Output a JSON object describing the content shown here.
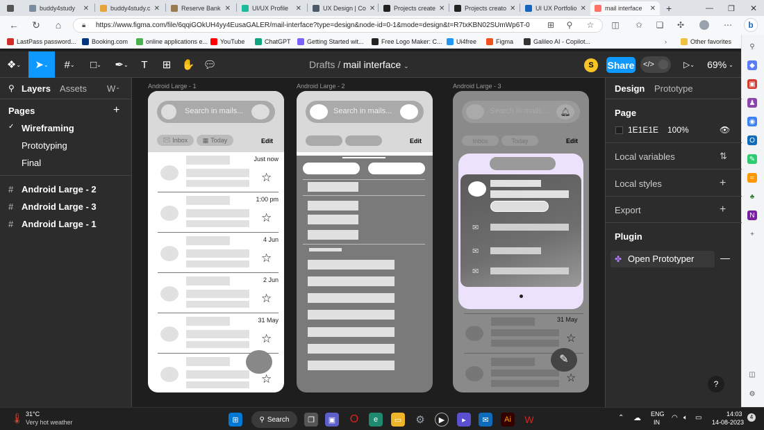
{
  "browser": {
    "tabs": [
      {
        "label": "",
        "active": false
      },
      {
        "label": "buddy4study",
        "active": false
      },
      {
        "label": "buddy4study.c",
        "active": false
      },
      {
        "label": "Reserve Bank",
        "active": false
      },
      {
        "label": "UI/UX Profile",
        "active": false
      },
      {
        "label": "UX Design | Co",
        "active": false
      },
      {
        "label": "Projects create",
        "active": false
      },
      {
        "label": "Projects creato",
        "active": false
      },
      {
        "label": "UI UX Portfolio",
        "active": false
      },
      {
        "label": "mail interface",
        "active": true
      }
    ],
    "url": "https://www.figma.com/file/6qqiGOkUH4yy4EusaGALER/mail-interface?type=design&node-id=0-1&mode=design&t=R7txKBN02SUmWp6T-0",
    "bookmarks": [
      {
        "label": "LastPass password...",
        "color": "#d32d27"
      },
      {
        "label": "Booking.com",
        "color": "#003580"
      },
      {
        "label": "online applications e...",
        "color": "#4caf50"
      },
      {
        "label": "YouTube",
        "color": "#ff0000"
      },
      {
        "label": "ChatGPT",
        "color": "#10a37f"
      },
      {
        "label": "Getting Started wit...",
        "color": "#7b61ff"
      },
      {
        "label": "Free Logo Maker: C...",
        "color": "#222222"
      },
      {
        "label": "Ui4free",
        "color": "#2196f3"
      },
      {
        "label": "Figma",
        "color": "#f24e1e"
      },
      {
        "label": "Galileo AI - Copilot...",
        "color": "#333333"
      }
    ],
    "other_favorites": "Other favorites"
  },
  "figma": {
    "breadcrumb_root": "Drafts",
    "breadcrumb_sep": "/",
    "file_name": "mail interface",
    "avatar_initial": "S",
    "share_label": "Share",
    "zoom": "69%",
    "left_tabs": {
      "layers": "Layers",
      "assets": "Assets",
      "more": "W"
    },
    "pages_title": "Pages",
    "pages": [
      "Wireframing",
      "Prototyping",
      "Final"
    ],
    "active_page_check": "✓",
    "frames": [
      "Android Large - 2",
      "Android Large - 3",
      "Android Large - 1"
    ],
    "right_tabs": {
      "design": "Design",
      "prototype": "Prototype"
    },
    "page_section": "Page",
    "page_color": "1E1E1E",
    "page_opacity": "100%",
    "sections": [
      "Local variables",
      "Local styles",
      "Export"
    ],
    "plugin_title": "Plugin",
    "plugin_name": "Open Prototyper",
    "help": "?"
  },
  "canvas": {
    "frame_labels": [
      "Android Large - 1",
      "Android Large - 2",
      "Android Large - 3"
    ],
    "search_placeholder": "Search in mails...",
    "chip_inbox": "Inbox",
    "chip_today": "Today",
    "edit": "Edit",
    "times": [
      "Just now",
      "1:00 pm",
      "4 Jun",
      "2 Jun",
      "31 May",
      ""
    ],
    "frame3_dates": [
      "31 May"
    ]
  },
  "taskbar": {
    "temp": "31°C",
    "weather": "Very hot weather",
    "search": "Search",
    "lang": "ENG",
    "region": "IN",
    "time": "14:03",
    "date": "14-08-2023"
  }
}
